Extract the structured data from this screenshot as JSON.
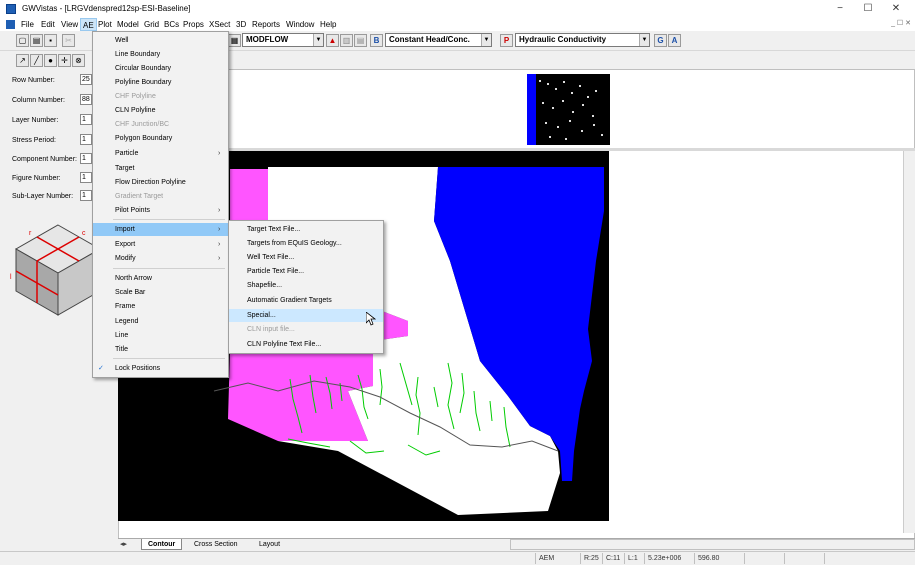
{
  "window": {
    "title": "GWVistas - [LRGVdenspred12sp-ESI-Baseline]",
    "minimize_glyph": "−",
    "maximize_glyph": "☐",
    "close_glyph": "✕",
    "mdi_controls": "_ ☐ ✕"
  },
  "menubar": [
    "File",
    "Edit",
    "View",
    "AE",
    "Plot",
    "Model",
    "Grid",
    "BCs",
    "Props",
    "XSect",
    "3D",
    "Reports",
    "Window",
    "Help"
  ],
  "toolbar": {
    "model_combo": "MODFLOW",
    "bc_combo": "Constant Head/Conc.",
    "prop_combo": "Hydraulic Conductivity"
  },
  "left_panel": {
    "fields": [
      {
        "label": "Row Number:",
        "value": "25"
      },
      {
        "label": "Column Number:",
        "value": "88"
      },
      {
        "label": "Layer Number:",
        "value": "1"
      },
      {
        "label": "Stress Period:",
        "value": "1"
      },
      {
        "label": "Component Number:",
        "value": "1"
      },
      {
        "label": "Figure Number:",
        "value": "1"
      },
      {
        "label": "Sub-Layer Number:",
        "value": "1"
      }
    ],
    "cube_labels": {
      "r": "r",
      "c": "c",
      "l": "l"
    }
  },
  "ae_menu": {
    "items": [
      {
        "label": "Well",
        "disabled": false
      },
      {
        "label": "Line Boundary",
        "disabled": false
      },
      {
        "label": "Circular Boundary",
        "disabled": false
      },
      {
        "label": "Polyline Boundary",
        "disabled": false
      },
      {
        "label": "CHF Polyline",
        "disabled": true
      },
      {
        "label": "CLN Polyline",
        "disabled": false
      },
      {
        "label": "CHF Junction/BC",
        "disabled": true
      },
      {
        "label": "Polygon Boundary",
        "disabled": false
      },
      {
        "label": "Particle",
        "disabled": false,
        "submenu": true
      },
      {
        "label": "Target",
        "disabled": false
      },
      {
        "label": "Flow Direction Polyline",
        "disabled": false
      },
      {
        "label": "Gradient Target",
        "disabled": true
      },
      {
        "label": "Pilot Points",
        "disabled": false,
        "submenu": true
      },
      {
        "label": "Import",
        "disabled": false,
        "submenu": true,
        "highlight": true
      },
      {
        "label": "Export",
        "disabled": false,
        "submenu": true
      },
      {
        "label": "Modify",
        "disabled": false,
        "submenu": true
      },
      {
        "label": "North Arrow",
        "disabled": false
      },
      {
        "label": "Scale Bar",
        "disabled": false
      },
      {
        "label": "Frame",
        "disabled": false
      },
      {
        "label": "Legend",
        "disabled": false
      },
      {
        "label": "Line",
        "disabled": false
      },
      {
        "label": "Title",
        "disabled": false
      },
      {
        "label": "Lock Positions",
        "disabled": false,
        "checked": true
      }
    ]
  },
  "import_menu": {
    "items": [
      {
        "label": "Target Text File...",
        "disabled": false
      },
      {
        "label": "Targets from EQuIS Geology...",
        "disabled": false
      },
      {
        "label": "Well Text File...",
        "disabled": false
      },
      {
        "label": "Particle Text File...",
        "disabled": false
      },
      {
        "label": "Shapefile...",
        "disabled": false
      },
      {
        "label": "Automatic Gradient Targets",
        "disabled": false
      },
      {
        "label": "Special...",
        "disabled": false,
        "hover": true
      },
      {
        "label": "CLN input file...",
        "disabled": true
      },
      {
        "label": "CLN Polyline Text File...",
        "disabled": false
      }
    ]
  },
  "tabs": [
    "Contour",
    "Cross Section",
    "Layout"
  ],
  "statusbar": {
    "mode": "AEM",
    "row": "R:25",
    "col": "C:11",
    "layer": "L:1",
    "x": "5.23e+006",
    "y": "596.80"
  },
  "colors": {
    "menu_highlight": "#91c9f7",
    "map_magenta": "#ff55ff",
    "map_blue": "#0000ff",
    "map_green": "#00cc00"
  }
}
